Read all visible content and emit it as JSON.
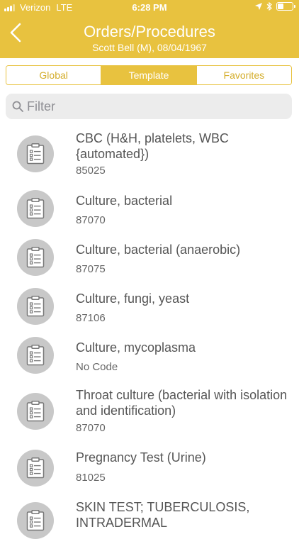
{
  "status_bar": {
    "carrier": "Verizon",
    "network": "LTE",
    "time": "6:28 PM"
  },
  "header": {
    "title": "Orders/Procedures",
    "subtitle": "Scott Bell (M), 08/04/1967",
    "back_icon": "chevron-left-icon"
  },
  "tabs": [
    {
      "label": "Global",
      "active": false
    },
    {
      "label": "Template",
      "active": true
    },
    {
      "label": "Favorites",
      "active": false
    }
  ],
  "search": {
    "placeholder": "Filter",
    "value": ""
  },
  "items": [
    {
      "name": "CBC (H&H, platelets, WBC {automated})",
      "code": "85025"
    },
    {
      "name": "Culture, bacterial",
      "code": "87070"
    },
    {
      "name": "Culture, bacterial (anaerobic)",
      "code": "87075"
    },
    {
      "name": "Culture, fungi, yeast",
      "code": "87106"
    },
    {
      "name": "Culture, mycoplasma",
      "code": "No Code"
    },
    {
      "name": "Throat culture (bacterial with isolation and identification)",
      "code": "87070"
    },
    {
      "name": "Pregnancy Test (Urine)",
      "code": "81025"
    },
    {
      "name": "SKIN TEST; TUBERCULOSIS, INTRADERMAL",
      "code": ""
    }
  ],
  "colors": {
    "accent": "#e8c23f",
    "avatar_bg": "#c8c8c8"
  },
  "item_icon": "clipboard-list-icon"
}
